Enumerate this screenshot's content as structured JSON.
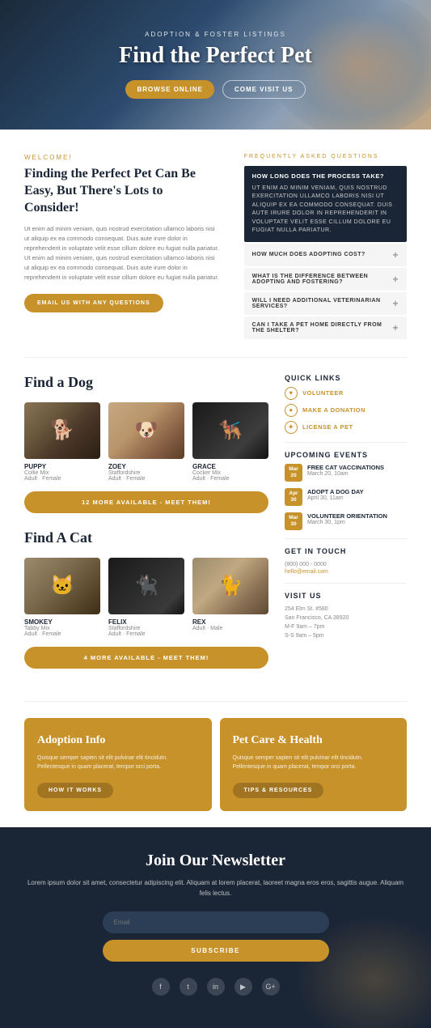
{
  "hero": {
    "subtitle": "Adoption & Foster Listings",
    "title": "Find the Perfect Pet",
    "btn_browse": "Browse Online",
    "btn_come": "Come Visit Us"
  },
  "welcome": {
    "label": "Welcome!",
    "title": "Finding the Perfect Pet Can Be Easy, But There's Lots to Consider!",
    "text1": "Ut enim ad minim veniam, quis nostrud exercitation ullamco laboris nisi ut aliquip ex ea commodo consequat. Duis aute irure dolor in reprehenderit in voluptate velit esse cillum dolore eu fugiat nulla pariatur. Ut enim ad minim veniam, quis nostrud exercitation ullamco laboris nisi ut aliquip ex ea commodo consequat. Duis aute irure dolor in reprehenderit in voluptate velit esse cillum dolore eu fugiat nulla pariatur.",
    "email_btn": "Email Us With Any Questions"
  },
  "faq": {
    "label": "Frequently Asked Questions",
    "items": [
      {
        "question": "How Long Does The Process Take?",
        "answer": "Ut enim ad minim veniam, quis nostrud exercitation ullamco laboris nisi ut aliquip ex ea commodo consequat. Duis aute irure dolor in reprehenderit in voluptate velit esse cillum dolore eu fugiat nulla pariatur.",
        "open": true
      },
      {
        "question": "How Much Does Adopting Cost?",
        "open": false
      },
      {
        "question": "What Is The Difference Between Adopting And Fostering?",
        "open": false
      },
      {
        "question": "Will I Need Additional Veterinarian Services?",
        "open": false
      },
      {
        "question": "Can I Take A Pet Home Directly From The Shelter?",
        "open": false
      }
    ]
  },
  "dogs": {
    "section_title": "Find a Dog",
    "more_btn": "12 More Available - Meet Them!",
    "pets": [
      {
        "name": "PUPPY",
        "breed": "Collie Mix",
        "details": "Adult · Female"
      },
      {
        "name": "ZOEY",
        "breed": "Staffordshire",
        "details": "Adult · Female"
      },
      {
        "name": "GRACE",
        "breed": "Cocker Mix",
        "details": "Adult · Female"
      }
    ]
  },
  "cats": {
    "section_title": "Find A Cat",
    "more_btn": "4 More Available - Meet Them!",
    "pets": [
      {
        "name": "SMOKEY",
        "breed": "Tabby Mix",
        "details": "Adult · Female"
      },
      {
        "name": "FELIX",
        "breed": "Staffordshire",
        "details": "Adult · Female"
      },
      {
        "name": "REX",
        "breed": "",
        "details": "Adult · Male"
      }
    ]
  },
  "sidebar": {
    "quick_links_title": "Quick Links",
    "links": [
      {
        "label": "Volunteer",
        "icon": "♥"
      },
      {
        "label": "Make A Donation",
        "icon": "●"
      },
      {
        "label": "License A Pet",
        "icon": "✦"
      }
    ],
    "events_title": "Upcoming Events",
    "events": [
      {
        "month": "Mar",
        "day": "20",
        "name": "Free Cat Vaccinations",
        "date": "March 20, 10am"
      },
      {
        "month": "Apr",
        "day": "30",
        "name": "Adopt A Dog Day",
        "date": "April 30, 11am"
      },
      {
        "month": "Mar",
        "day": "30",
        "name": "Volunteer Orientation",
        "date": "March 30, 1pm"
      }
    ],
    "contact_title": "Get In Touch",
    "phone": "(800) 000 - 0000",
    "email": "hello@email.com",
    "visit_title": "Visit Us",
    "address": "254 Elm St. #580\nSan Francisco, CA 38920\nM-F 9am - 7pm\nS-S 9am - 5pm"
  },
  "adoption_info": {
    "card1_title": "Adoption Info",
    "card1_text": "Quisque semper sapien sit elit pulvinar elit tincidutn. Pellentesque in quam placerat, tempor orci porta.",
    "card1_btn": "How It Works",
    "card2_title": "Pet Care & Health",
    "card2_text": "Quisque semper sapien sit elit pulvinar elit tincidutn. Pellentesque in quam placerat, tempor orci porta.",
    "card2_btn": "Tips & Resources"
  },
  "newsletter": {
    "title": "Join Our Newsletter",
    "text": "Lorem ipsum dolor sit amet, consectetur adipiscing elit.\nAliquam at lorem placerat, laoreet magna eros eros, sagittis\naugue. Aliquam felis lectus.",
    "email_placeholder": "Email",
    "subscribe_btn": "Subscribe",
    "social": [
      "f",
      "t",
      "in",
      "yt",
      "G+"
    ]
  }
}
